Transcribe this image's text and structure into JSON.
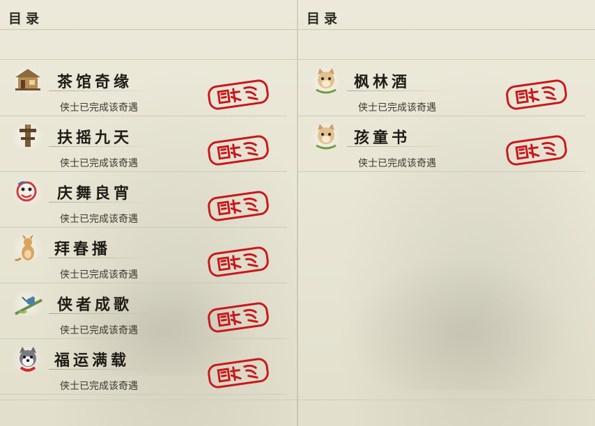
{
  "left_page": {
    "header": "目录",
    "entries": [
      {
        "name": "茶馆奇缘",
        "status": "侠士已完成该奇遇",
        "icon": "teahouse-icon"
      },
      {
        "name": "扶摇九天",
        "status": "侠士已完成该奇遇",
        "icon": "totem-pole-icon"
      },
      {
        "name": "庆舞良宵",
        "status": "侠士已完成该奇遇",
        "icon": "lion-dance-icon"
      },
      {
        "name": "拜春播",
        "status": "侠士已完成该奇遇",
        "icon": "kangaroo-icon"
      },
      {
        "name": "侠者成歌",
        "status": "侠士已完成该奇遇",
        "icon": "bird-branch-icon"
      },
      {
        "name": "福运满载",
        "status": "侠士已完成该奇遇",
        "icon": "husky-dog-icon"
      }
    ]
  },
  "right_page": {
    "header": "目录",
    "entries": [
      {
        "name": "枫林酒",
        "status": "侠士已完成该奇遇",
        "icon": "cat-icon"
      },
      {
        "name": "孩童书",
        "status": "侠士已完成该奇遇",
        "icon": "cat-icon"
      }
    ]
  },
  "colors": {
    "stamp_red": "#c8181c",
    "paper": "#e9e6d6",
    "ink": "#1e1c16"
  }
}
